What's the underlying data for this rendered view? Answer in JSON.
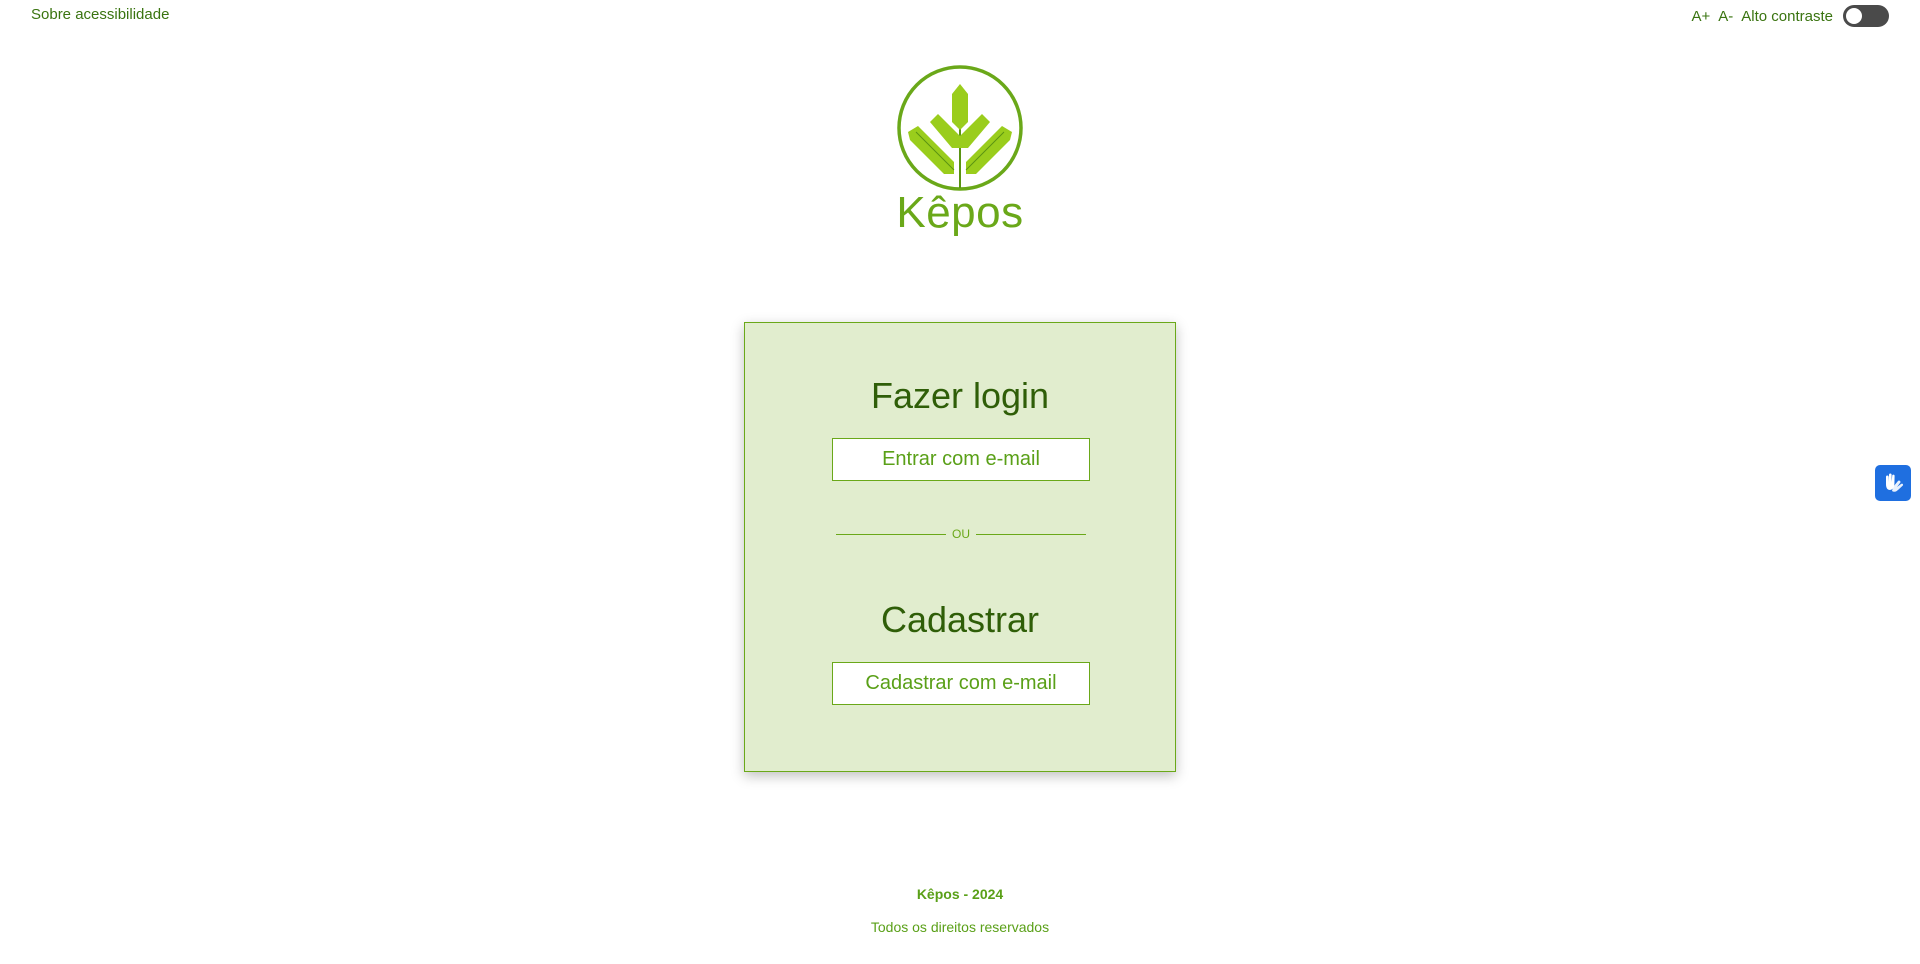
{
  "topbar": {
    "about_accessibility": "Sobre acessibilidade",
    "font_increase": "A+",
    "font_decrease": "A-",
    "high_contrast_label": "Alto contraste",
    "high_contrast_on": false
  },
  "brand": {
    "name": "Kêpos",
    "color": "#6aa819"
  },
  "card": {
    "login_title": "Fazer login",
    "login_button": "Entrar com e-mail",
    "divider_text": "OU",
    "signup_title": "Cadastrar",
    "signup_button": "Cadastrar com e-mail",
    "background": "#e1edce"
  },
  "footer": {
    "title": "Kêpos - 2024",
    "rights": "Todos os direitos reservados"
  },
  "icons": {
    "logo": "leaf-logo-icon",
    "sign_language": "hands-sign-language-icon"
  }
}
